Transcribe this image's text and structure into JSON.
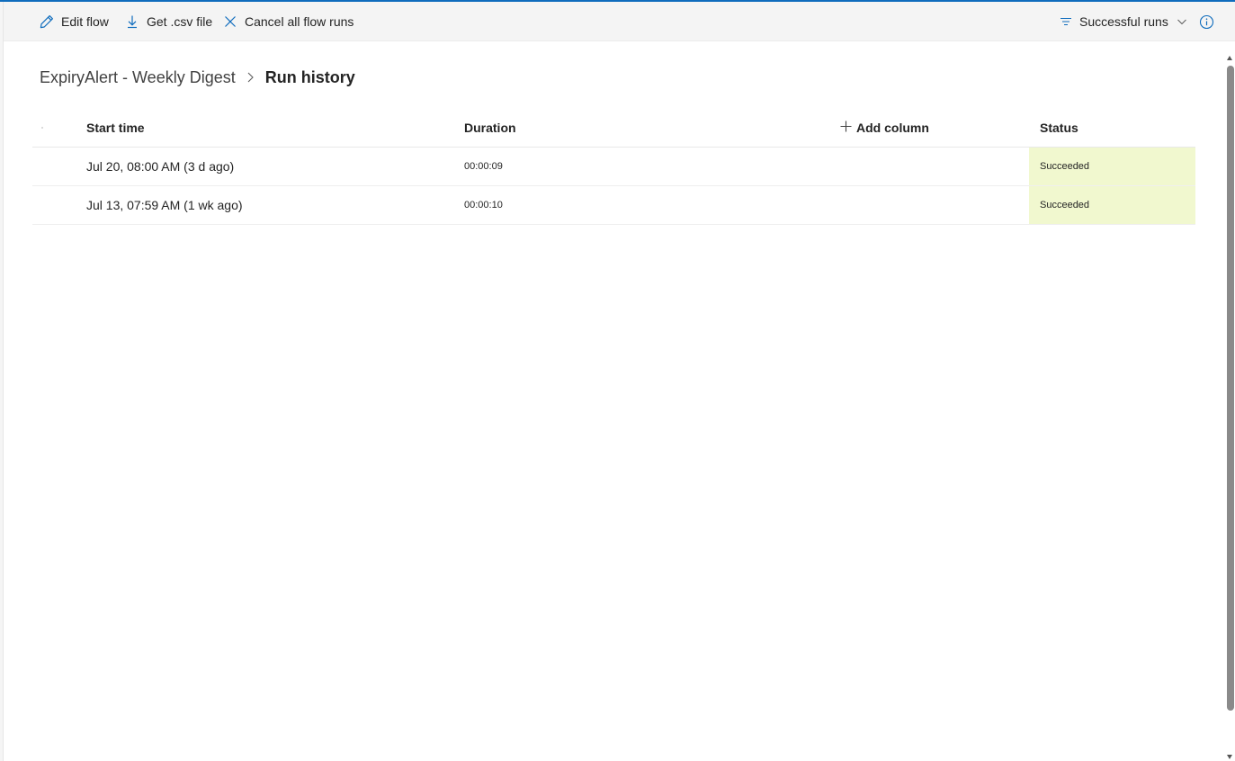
{
  "toolbar": {
    "edit_flow": "Edit flow",
    "get_csv": "Get .csv file",
    "cancel_runs": "Cancel all flow runs",
    "filter": "Successful runs"
  },
  "breadcrumb": {
    "parent": "ExpiryAlert - Weekly Digest",
    "current": "Run history"
  },
  "table": {
    "columns": {
      "start_time": "Start time",
      "duration": "Duration",
      "add_column": "Add column",
      "status": "Status"
    },
    "rows": [
      {
        "start_time": "Jul 20, 08:00 AM (3 d ago)",
        "duration": "00:00:09",
        "status": "Succeeded"
      },
      {
        "start_time": "Jul 13, 07:59 AM (1 wk ago)",
        "duration": "00:00:10",
        "status": "Succeeded"
      }
    ]
  },
  "colors": {
    "accent": "#0f6cbd",
    "success_bg": "#f1f8cf",
    "toolbar_bg": "#f4f4f4"
  },
  "icons": [
    "edit-icon",
    "download-icon",
    "cancel-icon",
    "filter-icon",
    "chevron-down-icon",
    "info-icon",
    "breadcrumb-chevron-icon",
    "add-icon"
  ]
}
